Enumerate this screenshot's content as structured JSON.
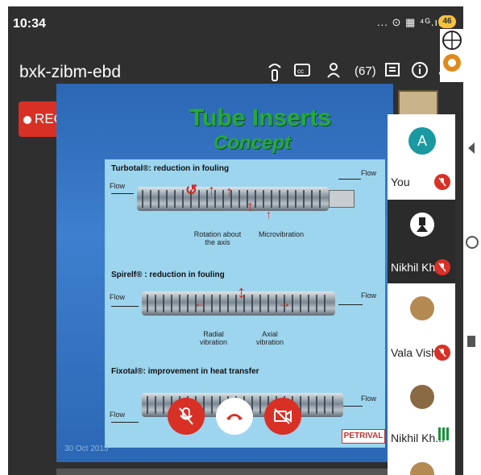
{
  "status_bar": {
    "time": "10:34",
    "icons_text": "... ⊙ ▦ ⁴ᴳ.ıl .ıl",
    "battery": "46"
  },
  "meeting": {
    "code": "bxk-zibm-ebd",
    "people_count": "(67)",
    "rec_label": "REC"
  },
  "slide": {
    "title": "Tube Inserts",
    "subtitle": "Concept",
    "sections": [
      {
        "heading": "Turbotal®: reduction in fouling",
        "flow_left": "Flow",
        "flow_right": "Flow",
        "labels": [
          "Rotation about the axis",
          "Microvibration"
        ]
      },
      {
        "heading": "Spirelf® : reduction in fouling",
        "flow_left": "Flow",
        "flow_right": "Flow",
        "labels": [
          "Radial vibration",
          "Axial vibration"
        ]
      },
      {
        "heading": "Fixotal®: improvement in heat transfer",
        "flow_left": "Flow",
        "flow_right": "Flow",
        "labels": []
      }
    ],
    "date": "30 Oct 2015",
    "logo": "PETRIVAL"
  },
  "participants": [
    {
      "name": "You",
      "initial": "A",
      "muted": true,
      "avatar_color": "#1a9aa0"
    },
    {
      "name": "Nikhil Kh...",
      "muted": true
    },
    {
      "name": "Vala Vish...",
      "muted": true
    },
    {
      "name": "Nikhil Kh...",
      "muted": false,
      "speaking": true
    }
  ],
  "colors": {
    "mute_red": "#d93025",
    "speaking_green": "#1e8e3e"
  }
}
